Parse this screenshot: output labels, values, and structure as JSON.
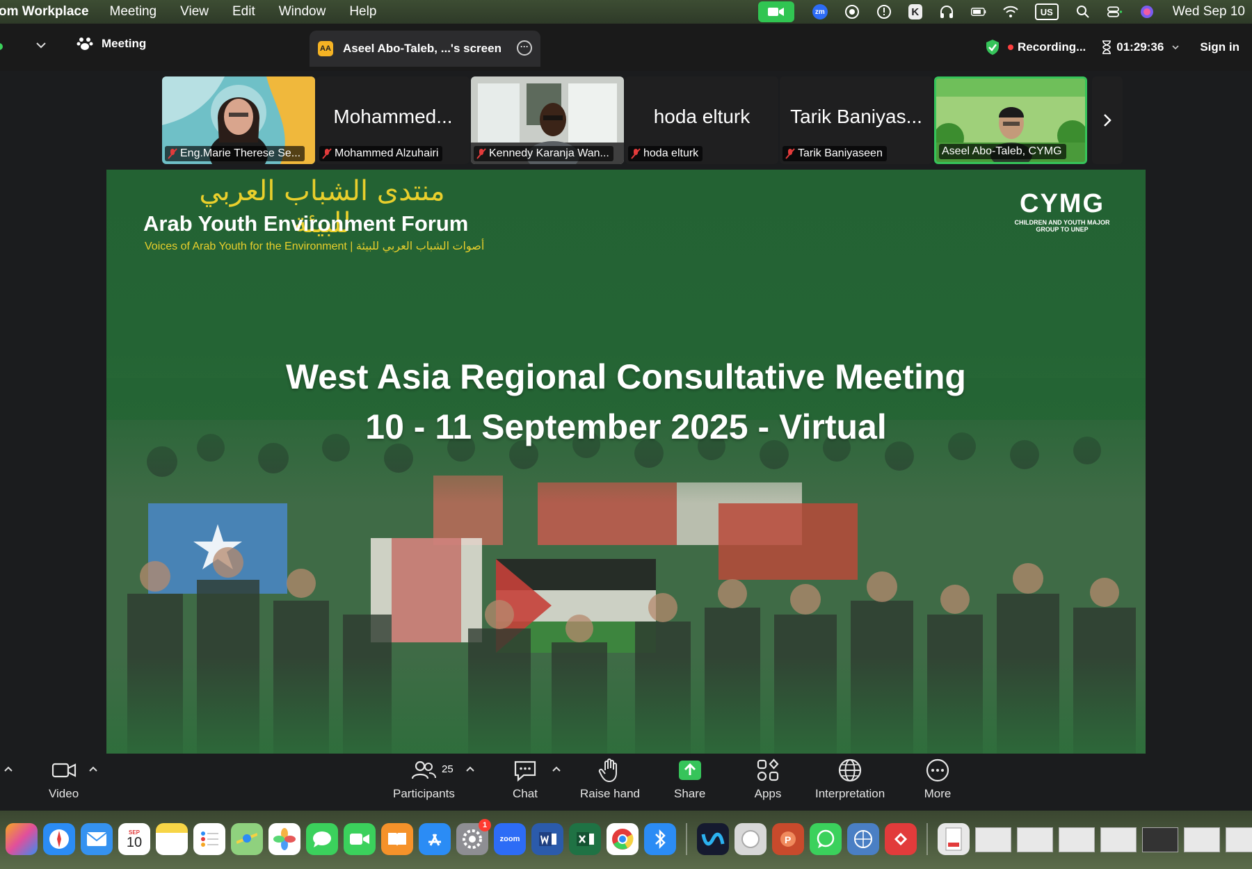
{
  "menubar": {
    "app_name": "om Workplace",
    "items": [
      "Meeting",
      "View",
      "Edit",
      "Window",
      "Help"
    ],
    "keyboard_layout": "US",
    "datetime": "Wed Sep 10"
  },
  "topbar": {
    "meeting_label": "Meeting",
    "tab_title": "Aseel Abo-Taleb, ...'s screen",
    "recording_label": "Recording...",
    "timer": "01:29:36",
    "sign_in": "Sign in"
  },
  "participants_strip": [
    {
      "display_name": "",
      "tag": "Eng.Marie Therese Se...",
      "has_video": true,
      "muted": true
    },
    {
      "display_name": "Mohammed...",
      "tag": "Mohammed Alzuhairi",
      "has_video": false,
      "muted": true
    },
    {
      "display_name": "",
      "tag": "Kennedy Karanja Wan...",
      "has_video": true,
      "muted": true
    },
    {
      "display_name": "hoda elturk",
      "tag": "hoda elturk",
      "has_video": false,
      "muted": true
    },
    {
      "display_name": "Tarik Baniyas...",
      "tag": "Tarik Baniyaseen",
      "has_video": false,
      "muted": true
    },
    {
      "display_name": "",
      "tag": "Aseel Abo-Taleb, CYMG",
      "has_video": true,
      "muted": false,
      "active": true
    }
  ],
  "slide": {
    "arabic_title": "منتدى الشباب العربي للبيئة",
    "forum_title": "Arab Youth Environment Forum",
    "forum_subtitle": "Voices of Arab Youth for the Environment |  أصوات الشباب العربي للبيئة",
    "logo_mark": "CYMG",
    "logo_text": "CHILDREN AND YOUTH MAJOR GROUP TO UNEP",
    "title_line1": "West Asia Regional Consultative Meeting",
    "title_line2": "10 - 11 September 2025 - Virtual"
  },
  "toolbar": {
    "video": "Video",
    "participants": "Participants",
    "participants_count": "25",
    "chat": "Chat",
    "raise_hand": "Raise hand",
    "share": "Share",
    "apps": "Apps",
    "interpretation": "Interpretation",
    "more": "More"
  },
  "dock": {
    "calendar_month": "SEP",
    "calendar_day": "10",
    "settings_badge": "1",
    "zoom_label": "zoom"
  },
  "colors": {
    "accent_green": "#36c45a",
    "slide_green": "#246434",
    "title_yellow": "#e9cf2c",
    "recording_red": "#ff4040"
  }
}
